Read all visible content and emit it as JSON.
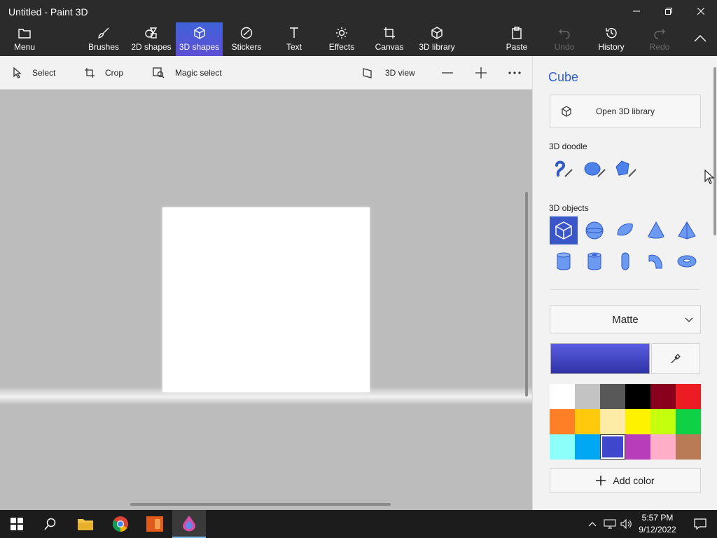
{
  "window": {
    "title": "Untitled - Paint 3D"
  },
  "ribbon": {
    "menu": "Menu",
    "tabs": [
      "Brushes",
      "2D shapes",
      "3D shapes",
      "Stickers",
      "Text",
      "Effects",
      "Canvas",
      "3D library"
    ],
    "paste": "Paste",
    "undo": "Undo",
    "history": "History",
    "redo": "Redo"
  },
  "toolbar": {
    "select": "Select",
    "crop": "Crop",
    "magic_select": "Magic select",
    "view_3d": "3D view"
  },
  "panel": {
    "title": "Cube",
    "open_library": "Open 3D library",
    "doodle_label": "3D doodle",
    "objects_label": "3D objects",
    "material": "Matte",
    "add_color": "Add color",
    "current_color": "#4b4fd6",
    "swatches": [
      "#ffffff",
      "#c3c3c3",
      "#585858",
      "#000000",
      "#88001b",
      "#ec1c24",
      "#ff7f27",
      "#ffc90e",
      "#fdeca6",
      "#fff200",
      "#c4ff0e",
      "#0ed145",
      "#8cfffb",
      "#00a8f3",
      "#3f48cc",
      "#b83dba",
      "#ffaec8",
      "#b97a56"
    ],
    "selected_swatch": 14
  },
  "taskbar": {
    "time": "5:57 PM",
    "date": "9/12/2022"
  }
}
